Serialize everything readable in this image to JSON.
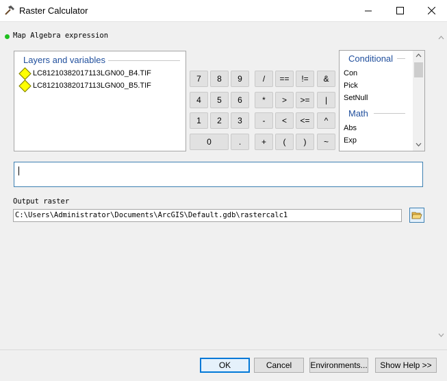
{
  "window": {
    "title": "Raster Calculator",
    "icons": {
      "app": "hammer-icon",
      "minimize": "minimize-icon",
      "maximize": "maximize-icon",
      "close": "close-icon"
    }
  },
  "expression_label": "Map Algebra expression",
  "layers": {
    "title": "Layers and variables",
    "items": [
      "LC81210382017113LGN00_B4.TIF",
      "LC81210382017113LGN00_B5.TIF"
    ]
  },
  "keypad": {
    "row1": [
      "7",
      "8",
      "9",
      "/",
      "==",
      "!=",
      "&"
    ],
    "row2": [
      "4",
      "5",
      "6",
      "*",
      ">",
      ">=",
      "|"
    ],
    "row3": [
      "1",
      "2",
      "3",
      "-",
      "<",
      "<=",
      "^"
    ],
    "row4": [
      "0",
      ".",
      "+",
      "(",
      ")",
      "~"
    ]
  },
  "functions": {
    "conditional_title": "Conditional",
    "conditional": [
      "Con",
      "Pick",
      "SetNull"
    ],
    "math_title": "Math",
    "math": [
      "Abs",
      "Exp"
    ]
  },
  "expression_value": "",
  "output": {
    "label": "Output raster",
    "value": "C:\\Users\\Administrator\\Documents\\ArcGIS\\Default.gdb\\rastercalc1"
  },
  "buttons": {
    "ok": "OK",
    "cancel": "Cancel",
    "environments": "Environments...",
    "help": "Show Help >>"
  },
  "colors": {
    "accent": "#0078d7",
    "heading": "#1f4e9c",
    "layer_icon": "#ffff00",
    "status_dot": "#1fc01f"
  }
}
